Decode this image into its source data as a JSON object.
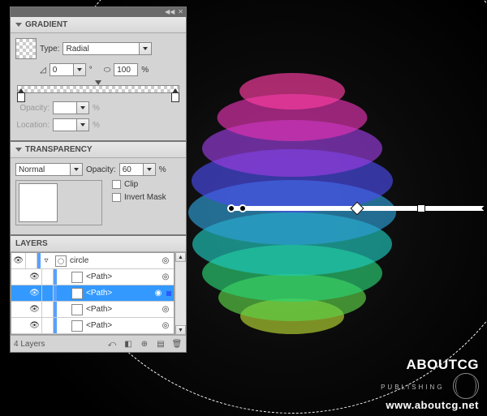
{
  "gradient": {
    "title": "GRADIENT",
    "type_label": "Type:",
    "type_value": "Radial",
    "angle": "0",
    "angle_unit": "°",
    "ratio": "100",
    "ratio_unit": "%",
    "opacity_label": "Opacity:",
    "opacity_unit": "%",
    "location_label": "Location:",
    "location_unit": "%"
  },
  "transparency": {
    "title": "TRANSPARENCY",
    "blend": "Normal",
    "opacity_label": "Opacity:",
    "opacity_value": "60",
    "opacity_unit": "%",
    "clip_label": "Clip",
    "invert_label": "Invert Mask"
  },
  "layers": {
    "title": "LAYERS",
    "rows": [
      {
        "name": "circle",
        "expanded": true
      },
      {
        "name": "<Path>"
      },
      {
        "name": "<Path>",
        "selected": true
      },
      {
        "name": "<Path>"
      },
      {
        "name": "<Path>"
      }
    ],
    "footer": "4 Layers"
  },
  "watermark": {
    "brand": "ABOUTCG",
    "sub": "PUBLISHING",
    "url": "www.aboutcg.net"
  }
}
